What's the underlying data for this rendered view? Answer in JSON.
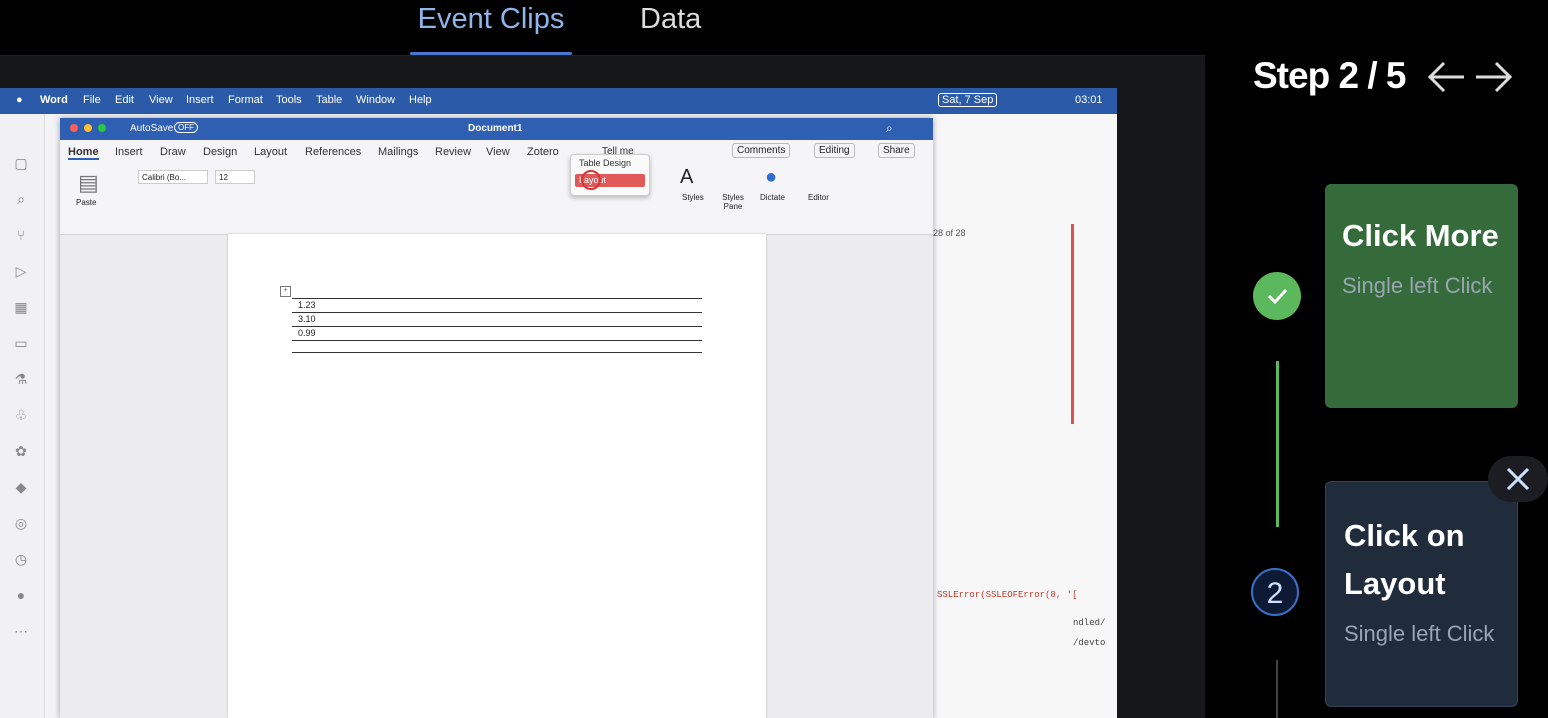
{
  "tabs": [
    {
      "label": "Event Clips"
    },
    {
      "label": "Data"
    }
  ],
  "step": {
    "title": "Step 2 / 5",
    "prev_icon": "arrow-left-icon",
    "next_icon": "arrow-right-icon"
  },
  "steps": [
    {
      "title": "Click More",
      "subtitle": "Single left Click",
      "status": "done"
    },
    {
      "number": "2",
      "title": "Click on Layout",
      "subtitle": "Single left Click",
      "status": "current"
    }
  ],
  "close_icon": "close-icon",
  "screenshot": {
    "menubar": {
      "apple": "",
      "app": "Word",
      "items": [
        "File",
        "Edit",
        "View",
        "Insert",
        "Format",
        "Tools",
        "Table",
        "Window",
        "Help"
      ],
      "date": "Sat, 7 Sep",
      "time": "03:01"
    },
    "word": {
      "autosave": "AutoSave",
      "autosave_state": "OFF",
      "doc_title": "Document1",
      "ribbon_tabs": [
        "Home",
        "Insert",
        "Draw",
        "Design",
        "Layout",
        "References",
        "Mailings",
        "Review",
        "View",
        "Zotero"
      ],
      "tell_me": "Tell me",
      "dropdown": {
        "item1": "Table Design",
        "item2": "Layout"
      },
      "comments": "Comments",
      "editing": "Editing",
      "share": "Share",
      "font": "Calibri (Bo...",
      "size": "12",
      "paste": "Paste",
      "styles": "Styles",
      "styles_pane": "Styles Pane",
      "dictate": "Dictate",
      "editor": "Editor",
      "table_cells": [
        "1.23",
        "3.10",
        "0.99"
      ]
    },
    "ide": {
      "find_count": "28 of 28",
      "error_text": "SSLError(SSLEOFError(8, '[",
      "line1": "ndled/",
      "line2": "/devto"
    }
  }
}
